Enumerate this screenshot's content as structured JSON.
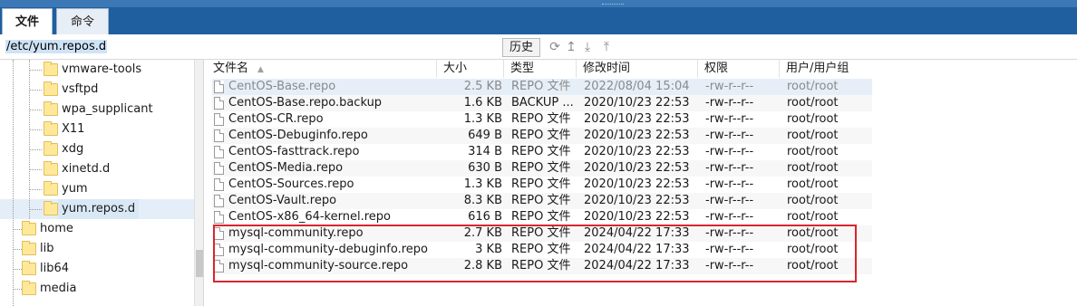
{
  "tabs": [
    {
      "label": "文件",
      "active": true
    },
    {
      "label": "命令",
      "active": false
    }
  ],
  "path": {
    "value": "/etc/yum.repos.d",
    "history_label": "历史"
  },
  "tree": {
    "items": [
      {
        "label": "vmware-tools",
        "level": 2
      },
      {
        "label": "vsftpd",
        "level": 2
      },
      {
        "label": "wpa_supplicant",
        "level": 2
      },
      {
        "label": "X11",
        "level": 2
      },
      {
        "label": "xdg",
        "level": 2
      },
      {
        "label": "xinetd.d",
        "level": 2
      },
      {
        "label": "yum",
        "level": 2
      },
      {
        "label": "yum.repos.d",
        "level": 2,
        "selected": true
      },
      {
        "label": "home",
        "level": 1
      },
      {
        "label": "lib",
        "level": 1
      },
      {
        "label": "lib64",
        "level": 1
      },
      {
        "label": "media",
        "level": 1
      }
    ]
  },
  "columns": {
    "name": "文件名",
    "size": "大小",
    "type": "类型",
    "mtime": "修改时间",
    "perm": "权限",
    "owner": "用户/用户组"
  },
  "files": [
    {
      "name": "CentOS-Base.repo",
      "size": "2.5 KB",
      "type": "REPO 文件",
      "mtime": "2022/08/04 15:04",
      "perm": "-rw-r--r--",
      "owner": "root/root"
    },
    {
      "name": "CentOS-Base.repo.backup",
      "size": "1.6 KB",
      "type": "BACKUP ...",
      "mtime": "2020/10/23 22:53",
      "perm": "-rw-r--r--",
      "owner": "root/root"
    },
    {
      "name": "CentOS-CR.repo",
      "size": "1.3 KB",
      "type": "REPO 文件",
      "mtime": "2020/10/23 22:53",
      "perm": "-rw-r--r--",
      "owner": "root/root"
    },
    {
      "name": "CentOS-Debuginfo.repo",
      "size": "649 B",
      "type": "REPO 文件",
      "mtime": "2020/10/23 22:53",
      "perm": "-rw-r--r--",
      "owner": "root/root"
    },
    {
      "name": "CentOS-fasttrack.repo",
      "size": "314 B",
      "type": "REPO 文件",
      "mtime": "2020/10/23 22:53",
      "perm": "-rw-r--r--",
      "owner": "root/root"
    },
    {
      "name": "CentOS-Media.repo",
      "size": "630 B",
      "type": "REPO 文件",
      "mtime": "2020/10/23 22:53",
      "perm": "-rw-r--r--",
      "owner": "root/root"
    },
    {
      "name": "CentOS-Sources.repo",
      "size": "1.3 KB",
      "type": "REPO 文件",
      "mtime": "2020/10/23 22:53",
      "perm": "-rw-r--r--",
      "owner": "root/root"
    },
    {
      "name": "CentOS-Vault.repo",
      "size": "8.3 KB",
      "type": "REPO 文件",
      "mtime": "2020/10/23 22:53",
      "perm": "-rw-r--r--",
      "owner": "root/root"
    },
    {
      "name": "CentOS-x86_64-kernel.repo",
      "size": "616 B",
      "type": "REPO 文件",
      "mtime": "2020/10/23 22:53",
      "perm": "-rw-r--r--",
      "owner": "root/root"
    },
    {
      "name": "mysql-community.repo",
      "size": "2.7 KB",
      "type": "REPO 文件",
      "mtime": "2024/04/22 17:33",
      "perm": "-rw-r--r--",
      "owner": "root/root"
    },
    {
      "name": "mysql-community-debuginfo.repo",
      "size": "3 KB",
      "type": "REPO 文件",
      "mtime": "2024/04/22 17:33",
      "perm": "-rw-r--r--",
      "owner": "root/root"
    },
    {
      "name": "mysql-community-source.repo",
      "size": "2.8 KB",
      "type": "REPO 文件",
      "mtime": "2024/04/22 17:33",
      "perm": "-rw-r--r--",
      "owner": "root/root"
    }
  ],
  "colors": {
    "tabbar": "#1f5fa0",
    "highlight": "#d9262c",
    "selection": "#d9e8f5"
  }
}
